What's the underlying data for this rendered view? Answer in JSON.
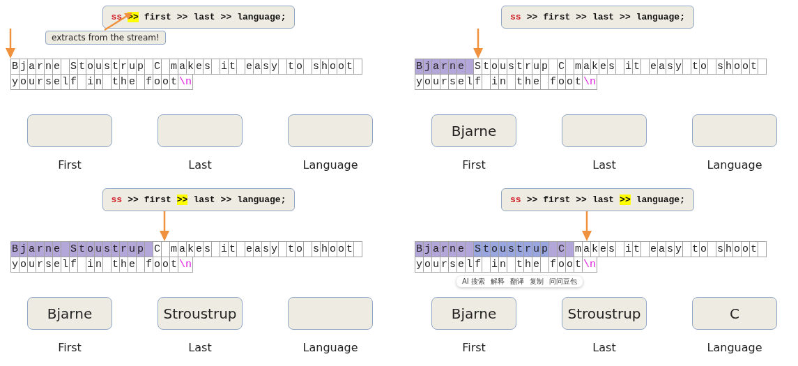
{
  "panels": [
    {
      "code": [
        {
          "text": "ss",
          "kind": "stream",
          "highlighted": false
        },
        {
          "text": ">>",
          "kind": "op",
          "highlighted": true
        },
        {
          "text": "first",
          "kind": "var",
          "highlighted": false
        },
        {
          "text": ">>",
          "kind": "op",
          "highlighted": false
        },
        {
          "text": "last",
          "kind": "var",
          "highlighted": false
        },
        {
          "text": ">>",
          "kind": "op",
          "highlighted": false
        },
        {
          "text": "language;",
          "kind": "var",
          "highlighted": false
        }
      ],
      "note": "extracts from the stream!",
      "line_1": [
        {
          "text": "Bjarne Stoustrup C makes it easy to shoot ",
          "consumed": false,
          "selected": false
        }
      ],
      "line_2": {
        "text": "yourself in the foot",
        "escape": "\\n"
      },
      "variables": [
        {
          "label": "First"
        },
        {
          "label": "Last"
        },
        {
          "label": "Language"
        }
      ]
    },
    {
      "code": [
        {
          "text": "ss",
          "kind": "stream",
          "highlighted": false
        },
        {
          "text": ">>",
          "kind": "op",
          "highlighted": false
        },
        {
          "text": "first",
          "kind": "var",
          "highlighted": false
        },
        {
          "text": ">>",
          "kind": "op",
          "highlighted": false
        },
        {
          "text": "last",
          "kind": "var",
          "highlighted": false
        },
        {
          "text": ">>",
          "kind": "op",
          "highlighted": false
        },
        {
          "text": "language;",
          "kind": "var",
          "highlighted": false
        }
      ],
      "line_1": [
        {
          "text": "Bjarne ",
          "consumed": true,
          "selected": false
        },
        {
          "text": "Stoustrup C makes it easy to shoot ",
          "consumed": false,
          "selected": false
        }
      ],
      "line_2": {
        "text": "yourself in the foot",
        "escape": "\\n"
      },
      "variables": [
        {
          "label": "First",
          "value": "Bjarne"
        },
        {
          "label": "Last"
        },
        {
          "label": "Language"
        }
      ]
    },
    {
      "code": [
        {
          "text": "ss",
          "kind": "stream",
          "highlighted": false
        },
        {
          "text": ">>",
          "kind": "op",
          "highlighted": false
        },
        {
          "text": "first",
          "kind": "var",
          "highlighted": false
        },
        {
          "text": ">>",
          "kind": "op",
          "highlighted": true
        },
        {
          "text": "last",
          "kind": "var",
          "highlighted": false
        },
        {
          "text": ">>",
          "kind": "op",
          "highlighted": false
        },
        {
          "text": "language;",
          "kind": "var",
          "highlighted": false
        }
      ],
      "line_1": [
        {
          "text": "Bjarne Stoustrup ",
          "consumed": true,
          "selected": false
        },
        {
          "text": "C makes it easy to shoot ",
          "consumed": false,
          "selected": false
        }
      ],
      "line_2": {
        "text": "yourself in the foot",
        "escape": "\\n"
      },
      "variables": [
        {
          "label": "First",
          "value": "Bjarne"
        },
        {
          "label": "Last",
          "value": "Stroustrup"
        },
        {
          "label": "Language"
        }
      ]
    },
    {
      "code": [
        {
          "text": "ss",
          "kind": "stream",
          "highlighted": false
        },
        {
          "text": ">>",
          "kind": "op",
          "highlighted": false
        },
        {
          "text": "first",
          "kind": "var",
          "highlighted": false
        },
        {
          "text": ">>",
          "kind": "op",
          "highlighted": false
        },
        {
          "text": "last",
          "kind": "var",
          "highlighted": false
        },
        {
          "text": ">>",
          "kind": "op",
          "highlighted": true
        },
        {
          "text": "language;",
          "kind": "var",
          "highlighted": false
        }
      ],
      "line_1": [
        {
          "text": "Bjarne ",
          "consumed": true,
          "selected": false
        },
        {
          "text": "Stoustrup",
          "consumed": true,
          "selected": true
        },
        {
          "text": " C ",
          "consumed": true,
          "selected": false
        },
        {
          "text": "makes it easy to shoot ",
          "consumed": false,
          "selected": false
        }
      ],
      "line_2": {
        "text": "yourself in the foot",
        "escape": "\\n"
      },
      "selection_toolbar": [
        "AI 搜索",
        "解释",
        "翻译",
        "复制",
        "问问豆包"
      ],
      "variables": [
        {
          "label": "First",
          "value": "Bjarne"
        },
        {
          "label": "Last",
          "value": "Stroustrup"
        },
        {
          "label": "Language",
          "value": "C"
        }
      ]
    }
  ]
}
